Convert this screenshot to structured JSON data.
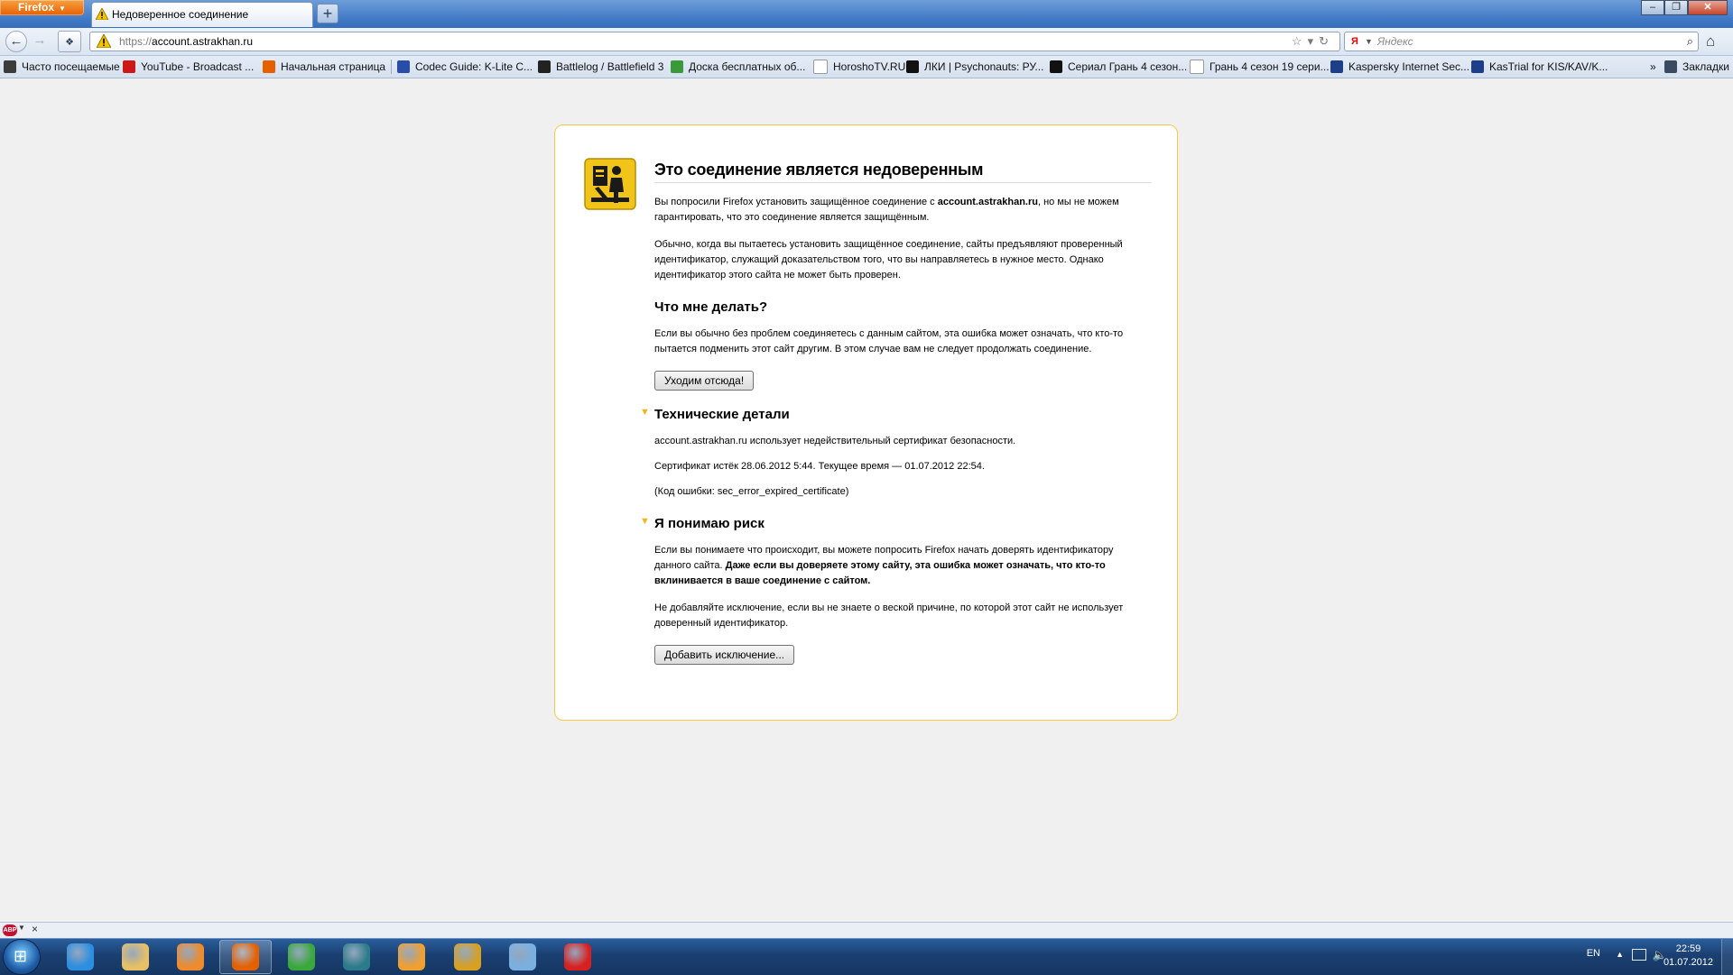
{
  "window": {
    "menu_button": "Firefox",
    "tab_title": "Недоверенное соединение",
    "new_tab": "+"
  },
  "navbar": {
    "url_scheme": "https://",
    "url_host": "account.astrakhan.ru",
    "search_placeholder": "Яндекс",
    "search_engine_icon": "Я"
  },
  "bookmarks": [
    {
      "label": "Часто посещаемые",
      "icon": "most-visited",
      "color": "#3c3c3c"
    },
    {
      "label": "YouTube - Broadcast ...",
      "icon": "youtube",
      "color": "#cc1818"
    },
    {
      "label": "Начальная страница",
      "icon": "firefox",
      "color": "#e66000"
    },
    {
      "label": "Codec Guide: K-Lite C...",
      "icon": "codec",
      "color": "#2a4da8"
    },
    {
      "label": "Battlelog / Battlefield 3",
      "icon": "battlelog",
      "color": "#222222"
    },
    {
      "label": "Доска бесплатных об...",
      "icon": "board",
      "color": "#3a9a3a"
    },
    {
      "label": "HoroshoTV.RU",
      "icon": "page",
      "color": "#ffffff"
    },
    {
      "label": "ЛКИ | Psychonauts: РУ...",
      "icon": "lki",
      "color": "#111111"
    },
    {
      "label": "Сериал Грань 4 сезон...",
      "icon": "cat",
      "color": "#111111"
    },
    {
      "label": "Грань 4 сезон 19 сери...",
      "icon": "page",
      "color": "#ffffff"
    },
    {
      "label": "Kaspersky Internet Sec...",
      "icon": "ru",
      "color": "#1d3f8a"
    },
    {
      "label": "KasTrial for KIS/KAV/K...",
      "icon": "ru",
      "color": "#1d3f8a"
    }
  ],
  "bookmarks_overflow": "»",
  "bookmarks_menu": "Закладки",
  "error": {
    "title": "Это соединение является недоверенным",
    "intro_pre": "Вы попросили Firefox установить защищённое соединение с ",
    "intro_host": "account.astrakhan.ru",
    "intro_post": ", но мы не можем гарантировать, что это соединение является защищённым.",
    "explain": "Обычно, когда вы пытаетесь установить защищённое соединение, сайты предъявляют проверенный идентификатор, служащий доказательством того, что вы направляетесь в нужное место. Однако идентификатор этого сайта не может быть проверен.",
    "what_heading": "Что мне делать?",
    "what_text": "Если вы обычно без проблем соединяетесь с данным сайтом, эта ошибка может означать, что кто-то пытается подменить этот сайт другим. В этом случае вам не следует продолжать соединение.",
    "get_me_out": "Уходим отсюда!",
    "tech_heading": "Технические детали",
    "tech_line1": "account.astrakhan.ru использует недействительный сертификат безопасности.",
    "tech_line2": "Сертификат истёк 28.06.2012 5:44. Текущее время — 01.07.2012 22:54.",
    "tech_line3": "(Код ошибки: sec_error_expired_certificate)",
    "risk_heading": "Я понимаю риск",
    "risk_text_pre": "Если вы понимаете что происходит, вы можете попросить Firefox начать доверять идентификатору данного сайта. ",
    "risk_text_bold": "Даже если вы доверяете этому сайту, эта ошибка может означать, что кто-то вклинивается в ваше соединение с сайтом.",
    "risk_note": "Не добавляйте исключение, если вы не знаете о веской причине, по которой этот сайт не использует доверенный идентификатор.",
    "add_exception": "Добавить исключение..."
  },
  "addonbar": {
    "abp_label": "ABP",
    "close": "×"
  },
  "taskbar": {
    "apps": [
      {
        "name": "internet-explorer",
        "state": "pinned",
        "color": "#2b8ee0"
      },
      {
        "name": "explorer",
        "state": "pinned",
        "color": "#e8c064"
      },
      {
        "name": "media-player",
        "state": "pinned",
        "color": "#f08a2a"
      },
      {
        "name": "firefox",
        "state": "running",
        "color": "#e66000"
      },
      {
        "name": "utorrent",
        "state": "pinned",
        "color": "#3aa83a"
      },
      {
        "name": "screen-app",
        "state": "pinned",
        "color": "#2c7b8a"
      },
      {
        "name": "chat-app",
        "state": "pinned",
        "color": "#f0a030"
      },
      {
        "name": "games-app",
        "state": "pinned",
        "color": "#d8a020"
      },
      {
        "name": "notes-app",
        "state": "pinned",
        "color": "#7ab0e0"
      },
      {
        "name": "recorder-app",
        "state": "pinned",
        "color": "#d82020"
      }
    ],
    "lang": "EN",
    "time": "22:59",
    "date": "01.07.2012"
  }
}
